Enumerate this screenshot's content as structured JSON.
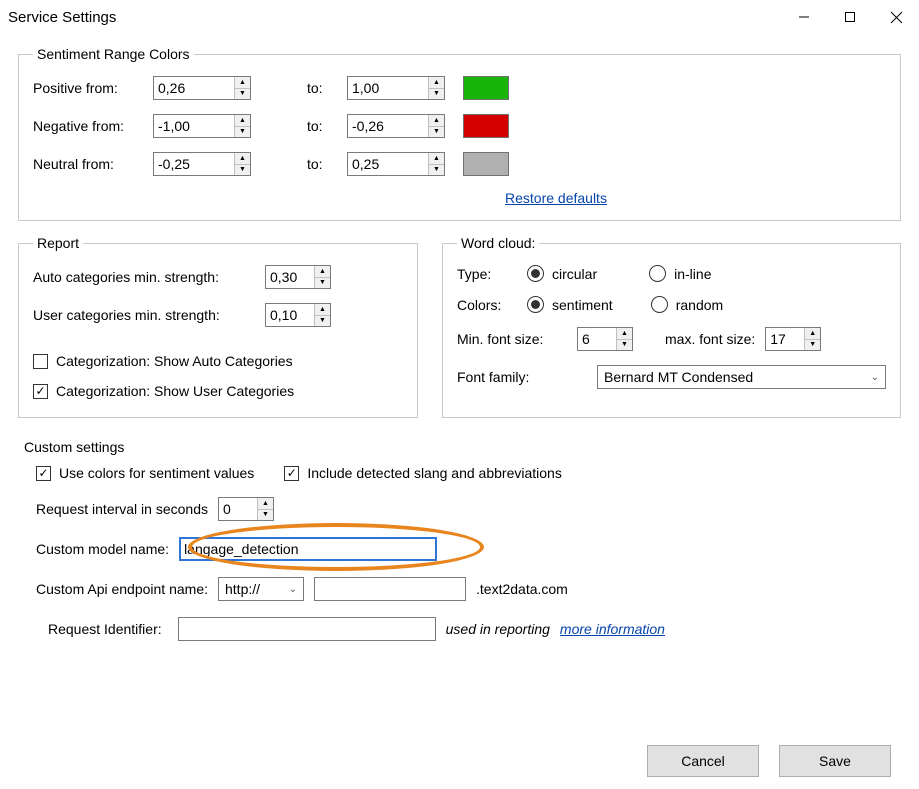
{
  "window": {
    "title": "Service Settings"
  },
  "sentiment": {
    "legend": "Sentiment Range Colors",
    "positive": {
      "label": "Positive from:",
      "from": "0,26",
      "to_label": "to:",
      "to": "1,00",
      "color": "#18b407"
    },
    "negative": {
      "label": "Negative from:",
      "from": "-1,00",
      "to_label": "to:",
      "to": "-0,26",
      "color": "#d40000"
    },
    "neutral": {
      "label": "Neutral from:",
      "from": "-0,25",
      "to_label": "to:",
      "to": "0,25",
      "color": "#b0b0b0"
    },
    "restore": "Restore defaults"
  },
  "report": {
    "legend": "Report",
    "auto_label": "Auto categories min. strength:",
    "auto_value": "0,30",
    "user_label": "User categories min. strength:",
    "user_value": "0,10",
    "show_auto": {
      "checked": false,
      "label": "Categorization: Show Auto Categories"
    },
    "show_user": {
      "checked": true,
      "label": "Categorization: Show User Categories"
    }
  },
  "wordcloud": {
    "legend": "Word cloud:",
    "type_label": "Type:",
    "type_circular": "circular",
    "type_inline": "in-line",
    "colors_label": "Colors:",
    "colors_sentiment": "sentiment",
    "colors_random": "random",
    "min_font_label": "Min. font size:",
    "min_font": "6",
    "max_font_label": "max. font size:",
    "max_font": "17",
    "family_label": "Font family:",
    "family_value": "Bernard MT Condensed"
  },
  "custom": {
    "legend": "Custom settings",
    "use_colors": {
      "checked": true,
      "label": "Use colors for sentiment values"
    },
    "include_slang": {
      "checked": true,
      "label": "Include detected slang and abbreviations"
    },
    "interval_label": "Request interval in seconds",
    "interval": "0",
    "model_label": "Custom model name:",
    "model_value": "langage_detection",
    "api_label": "Custom Api endpoint name:",
    "api_scheme": "http://",
    "api_host": "",
    "api_suffix": ".text2data.com",
    "request_id_label": "Request Identifier:",
    "request_id_value": "",
    "request_id_hint": "used in reporting",
    "more_info": "more information"
  },
  "buttons": {
    "cancel": "Cancel",
    "save": "Save"
  }
}
